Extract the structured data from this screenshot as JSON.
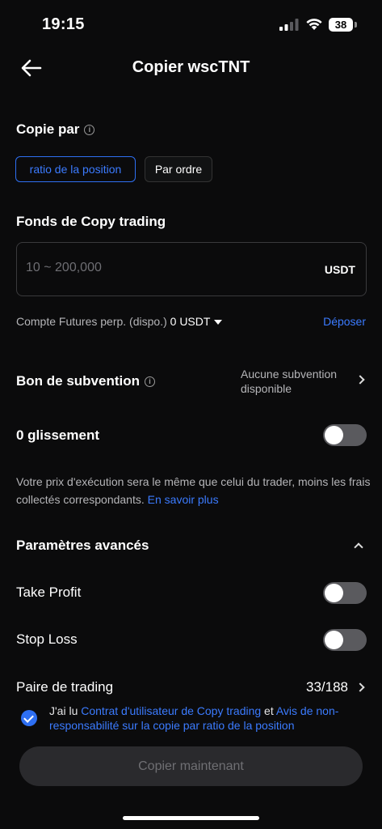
{
  "status_bar": {
    "time": "19:15",
    "battery": "38"
  },
  "header": {
    "title": "Copier wscTNT"
  },
  "copy_by": {
    "label": "Copie par",
    "options": [
      "ratio de la position",
      "Par ordre"
    ]
  },
  "funds": {
    "label": "Fonds de Copy trading",
    "placeholder": "10 ~ 200,000",
    "unit": "USDT"
  },
  "account": {
    "label": "Compte Futures perp. (dispo.)",
    "value": "0 USDT",
    "deposit_label": "Déposer"
  },
  "voucher": {
    "label": "Bon de subvention",
    "value_line1": "Aucune subvention",
    "value_line2": "disponible"
  },
  "slippage": {
    "label": "0 glissement",
    "enabled": false,
    "description": "Votre prix d'exécution sera le même que celui du trader, moins les frais collectés correspondants. ",
    "learn_more": "En savoir plus"
  },
  "advanced": {
    "label": "Paramètres avancés",
    "take_profit_label": "Take Profit",
    "take_profit_enabled": false,
    "stop_loss_label": "Stop Loss",
    "stop_loss_enabled": false,
    "trading_pair_label": "Paire de trading",
    "trading_pair_value": "33/188"
  },
  "agreement": {
    "checked": true,
    "prefix": "J'ai lu ",
    "link1": "Contrat d'utilisateur de Copy trading",
    "middle": " et ",
    "link2": "Avis de non-responsabilité sur la copie par ratio de la position"
  },
  "cta": {
    "label": "Copier maintenant"
  },
  "colors": {
    "accent": "#2e6ff2",
    "background": "#0b0b0c",
    "toggle_off": "#5a5a5e"
  }
}
